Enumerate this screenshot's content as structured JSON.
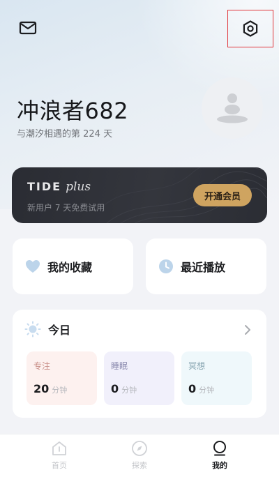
{
  "profile": {
    "username": "冲浪者682",
    "days_text": "与潮汐相遇的第 224 天"
  },
  "vip": {
    "logo_main": "TIDE",
    "logo_plus": "plus",
    "subtitle": "新用户 7 天免费试用",
    "button_label": "开通会员"
  },
  "quick_actions": {
    "favorites_label": "我的收藏",
    "recent_label": "最近播放"
  },
  "today": {
    "title": "今日",
    "stats": [
      {
        "label": "专注",
        "value": "20",
        "unit": "分钟"
      },
      {
        "label": "睡眠",
        "value": "0",
        "unit": "分钟"
      },
      {
        "label": "冥想",
        "value": "0",
        "unit": "分钟"
      }
    ]
  },
  "tabs": [
    {
      "label": "首页",
      "icon": "home-icon"
    },
    {
      "label": "探索",
      "icon": "compass-icon"
    },
    {
      "label": "我的",
      "icon": "profile-icon"
    }
  ],
  "icons": {
    "mail": "mail-icon",
    "settings": "settings-icon",
    "avatar": "zen-stones-icon",
    "heart": "heart-icon",
    "clock": "clock-icon",
    "sun": "sun-icon",
    "arrow": "chevron-right-icon"
  },
  "colors": {
    "vip_button": "#cfa460",
    "highlight_frame": "#e0353a",
    "focus_bg": "#fdf1ef",
    "sleep_bg": "#f1f0fb",
    "meditate_bg": "#eff8fb"
  }
}
